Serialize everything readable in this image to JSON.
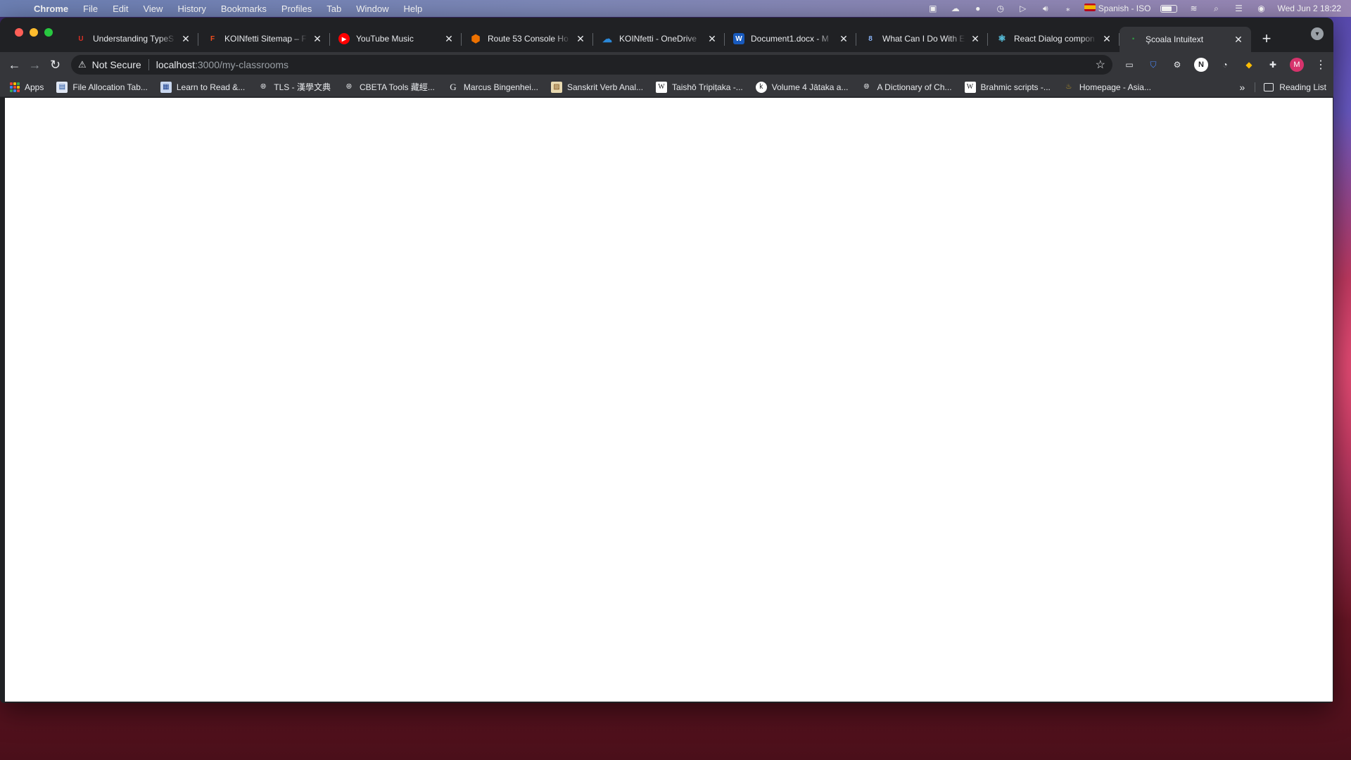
{
  "menubar": {
    "app": "Chrome",
    "items": [
      "File",
      "Edit",
      "View",
      "History",
      "Bookmarks",
      "Profiles",
      "Tab",
      "Window",
      "Help"
    ],
    "input_source": "Spanish - ISO",
    "datetime": "Wed Jun 2  18:22"
  },
  "tabs": [
    {
      "title": "Understanding TypeS",
      "favicon": "U",
      "favicon_color": "#d93025",
      "active": false
    },
    {
      "title": "KOINfetti Sitemap – F",
      "favicon": "F",
      "favicon_color": "#f24e1e",
      "active": false
    },
    {
      "title": "YouTube Music",
      "favicon": "▶",
      "favicon_color": "#ff0000",
      "active": false
    },
    {
      "title": "Route 53 Console Ho",
      "favicon": "⬢",
      "favicon_color": "#ed7100",
      "active": false
    },
    {
      "title": "KOINfetti - OneDrive",
      "favicon": "☁",
      "favicon_color": "#0364b8",
      "active": false
    },
    {
      "title": "Document1.docx - M",
      "favicon": "W",
      "favicon_color": "#185abd",
      "active": false
    },
    {
      "title": "What Can I Do With E",
      "favicon": "8",
      "favicon_color": "#3b5bdb",
      "active": false
    },
    {
      "title": "React Dialog compon",
      "favicon": "⚛",
      "favicon_color": "#3d8bfd",
      "active": false
    },
    {
      "title": "Şcoala Intuitext",
      "favicon": "·",
      "favicon_color": "#2f9e44",
      "active": true
    }
  ],
  "toolbar": {
    "security_label": "Not Secure",
    "url_host": "localhost",
    "url_path": ":3000/my-classrooms",
    "avatar_letter": "M",
    "n_extension": "N"
  },
  "bookmarks": {
    "items": [
      {
        "label": "Apps",
        "icon": "apps-grid-icon"
      },
      {
        "label": "File Allocation Tab...",
        "icon": "doc-image-icon"
      },
      {
        "label": "Learn to Read &...",
        "icon": "page-icon"
      },
      {
        "label": "TLS - 漢學文典",
        "icon": "globe-icon"
      },
      {
        "label": "CBETA Tools 藏經...",
        "icon": "globe-icon"
      },
      {
        "label": "Marcus Bingenhei...",
        "icon": "g-icon"
      },
      {
        "label": "Sanskrit Verb Anal...",
        "icon": "image-icon"
      },
      {
        "label": "Taishō Tripiṭaka -...",
        "icon": "w-icon"
      },
      {
        "label": "Volume 4 Jātaka a...",
        "icon": "k-icon"
      },
      {
        "label": "A Dictionary of Ch...",
        "icon": "globe-icon"
      },
      {
        "label": "Brahmic scripts -...",
        "icon": "w-icon"
      },
      {
        "label": "Homepage - Asia...",
        "icon": "flame-icon"
      }
    ],
    "more": "»",
    "reading_list": "Reading List"
  }
}
